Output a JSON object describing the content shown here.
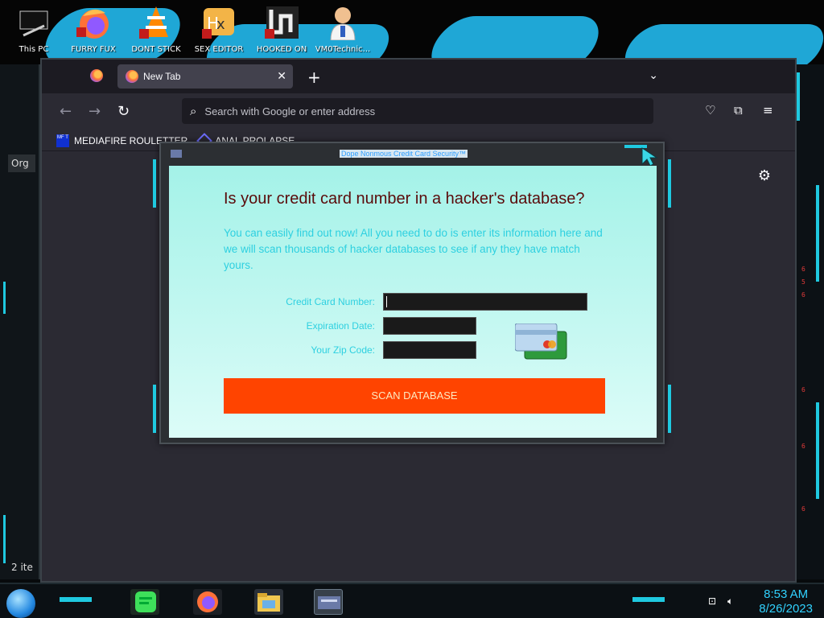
{
  "desktop": {
    "icons": [
      {
        "label": "This PC",
        "icon": "computer-icon"
      },
      {
        "label": "FURRY FUX",
        "icon": "firefox-icon"
      },
      {
        "label": "DONT STICK",
        "icon": "vlc-icon"
      },
      {
        "label": "SEX EDITOR",
        "icon": "hxd-icon"
      },
      {
        "label": "HOOKED ON",
        "icon": "maze-icon"
      },
      {
        "label": "VM0Technic...",
        "icon": "doctor-icon"
      }
    ],
    "left_panel": {
      "group_label": "Org",
      "status": "2 ite"
    }
  },
  "browser": {
    "tab": {
      "title": "New Tab"
    },
    "address_bar": {
      "placeholder": "Search with Google or enter address"
    },
    "bookmarks": [
      {
        "label": "MEDIAFIRE ROULETTER",
        "icon_text": "MF T"
      },
      {
        "label": "ANAL PROLAPSE"
      }
    ]
  },
  "popup": {
    "window_title": "Dope Nonmous Credit Card Security™",
    "headline": "Is your credit card number in a hacker's database?",
    "description": "You can easily find out now! All you need to do is enter its information here and we will scan thousands of hacker databases to see if any they have match yours.",
    "fields": {
      "card_number_label": "Credit Card Number:",
      "expiration_label": "Expiration Date:",
      "zip_label": "Your Zip Code:"
    },
    "button_label": "SCAN DATABASE"
  },
  "taskbar": {
    "time": "8:53 AM",
    "date": "8/26/2023"
  },
  "colors": {
    "popup_bg": "#a4f2e8",
    "headline": "#5a0b0b",
    "accent_text": "#2ed0e0",
    "scan_button": "#ff4400",
    "clock": "#31d2ff"
  }
}
